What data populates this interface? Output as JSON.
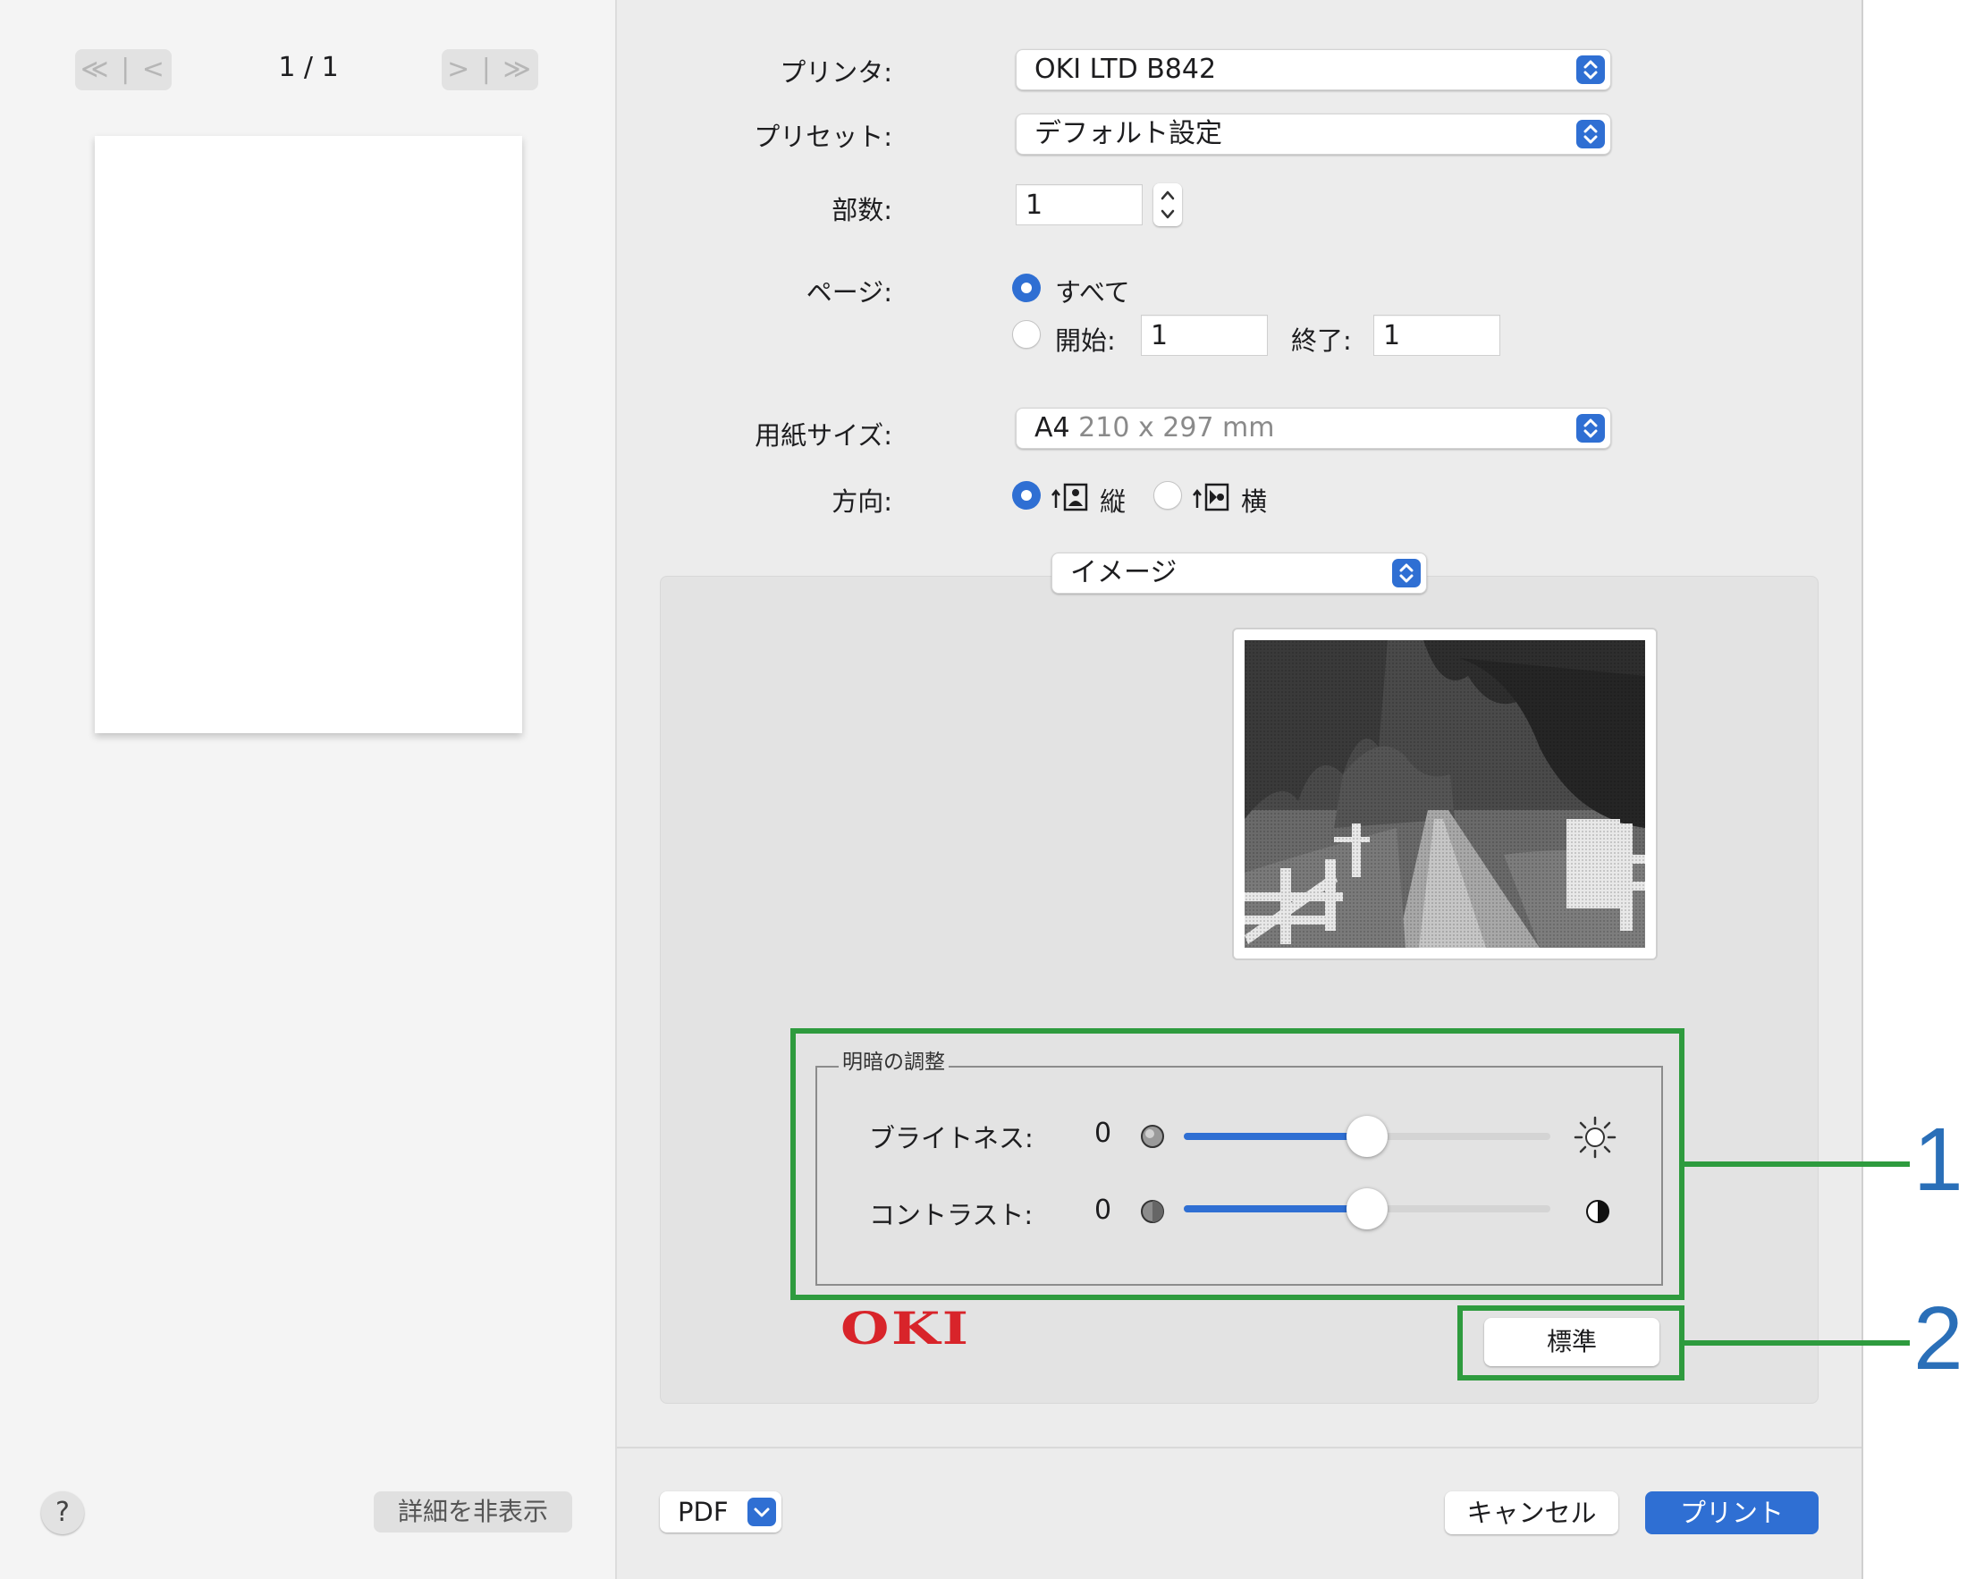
{
  "nav": {
    "first_prev": "≪ | <",
    "next_last": "> | ≫",
    "page_count": "1 / 1"
  },
  "left_buttons": {
    "help": "?",
    "hide_details": "詳細を非表示"
  },
  "printer": {
    "label": "プリンタ:",
    "value": "OKI LTD B842"
  },
  "preset": {
    "label": "プリセット:",
    "value": "デフォルト設定"
  },
  "copies": {
    "label": "部数:",
    "value": "1"
  },
  "pages": {
    "label": "ページ:",
    "all": "すべて",
    "from_label": "開始:",
    "from": "1",
    "to_label": "終了:",
    "to": "1"
  },
  "paper": {
    "label": "用紙サイズ:",
    "name": "A4",
    "dims": "210 x 297 mm"
  },
  "orientation": {
    "label": "方向:",
    "portrait": "縦",
    "landscape": "横"
  },
  "section": {
    "value": "イメージ"
  },
  "adjust": {
    "title": "明暗の調整",
    "brightness": {
      "label": "ブライトネス:",
      "value": "0",
      "level": 0.5
    },
    "contrast": {
      "label": "コントラスト:",
      "value": "0",
      "level": 0.5
    }
  },
  "standard_button": "標準",
  "logo": "OKI",
  "bottom": {
    "pdf": "PDF",
    "cancel": "キャンセル",
    "print": "プリント"
  },
  "callouts": [
    "1",
    "2"
  ],
  "colors": {
    "accent": "#2f6fd3",
    "highlight": "#2e9b3e",
    "callout_number": "#2a6fb8",
    "logo": "#d8242a"
  }
}
